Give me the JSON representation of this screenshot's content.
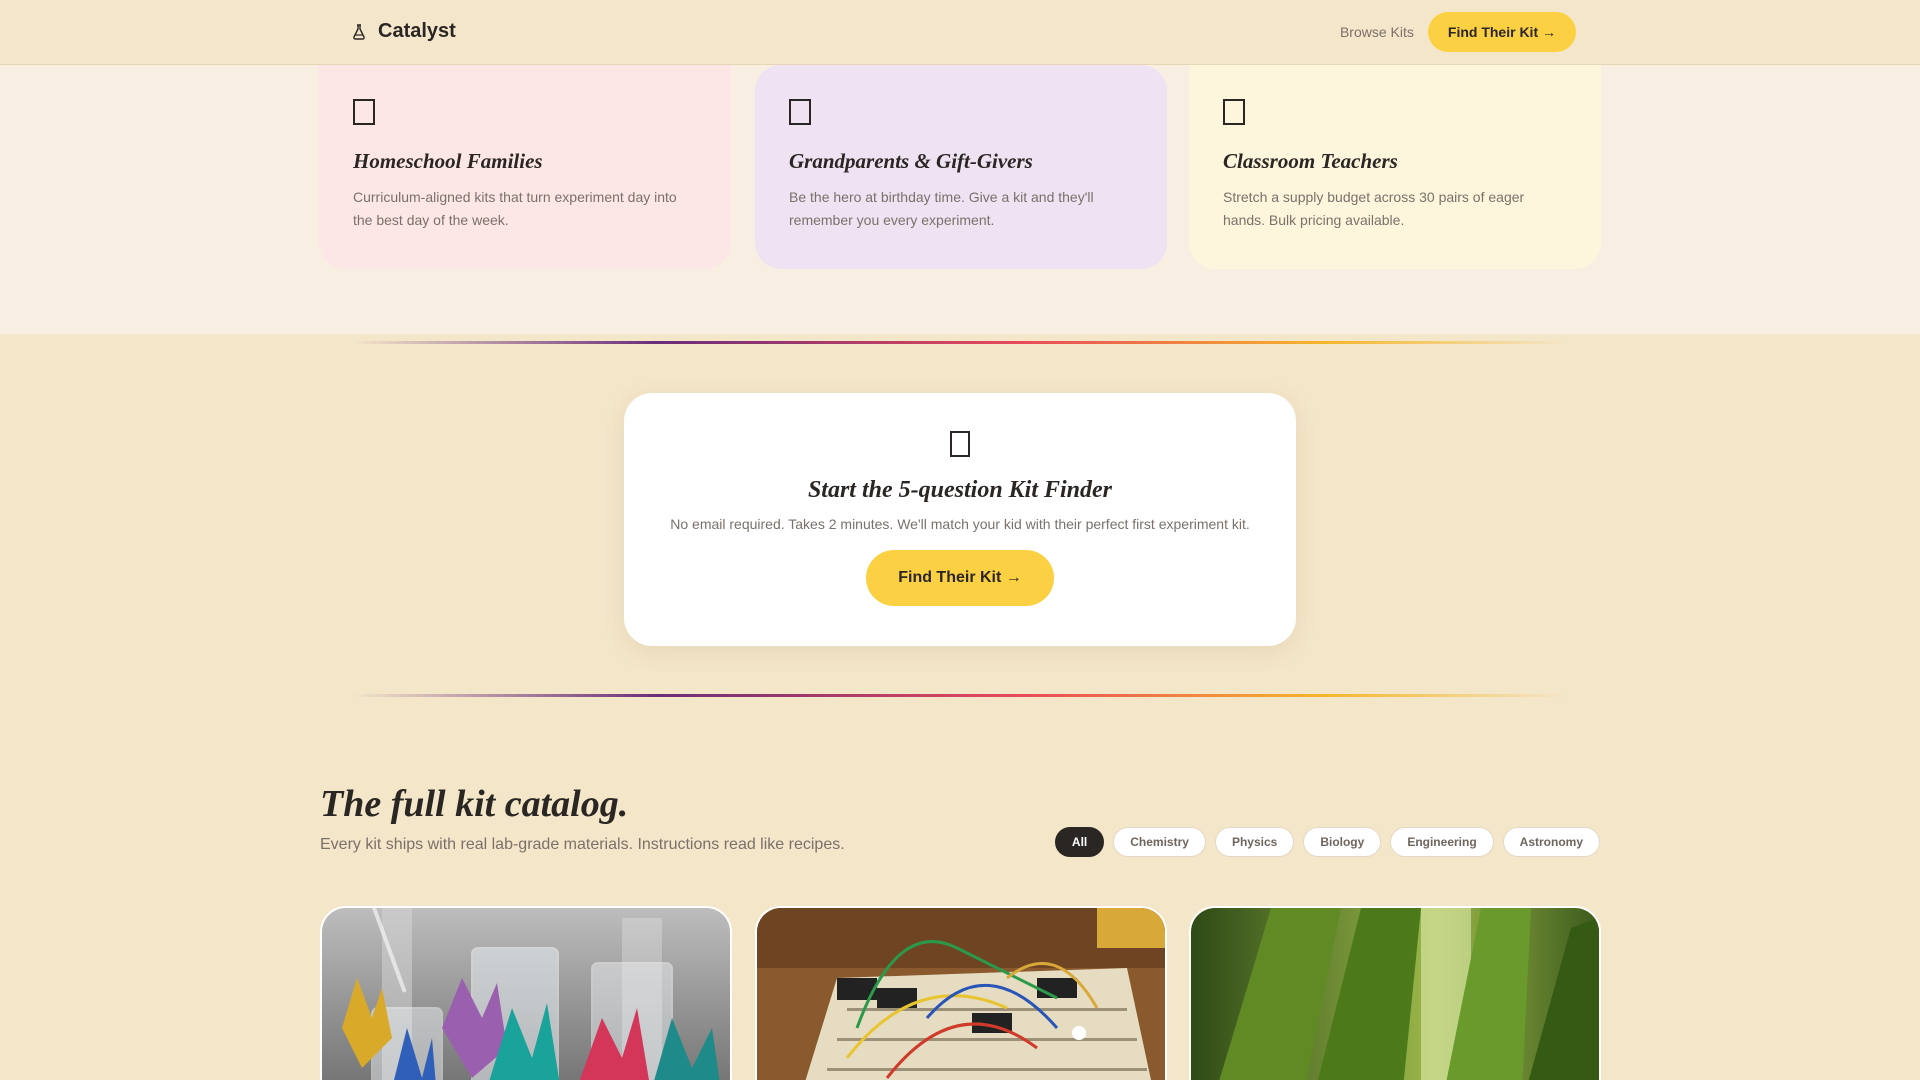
{
  "header": {
    "brand_name": "Catalyst",
    "brand_icon": "flask-icon",
    "nav_link": "Browse Kits",
    "cta_label": "Find Their Kit →"
  },
  "audience": {
    "cards": [
      {
        "icon": "missing-glyph-icon",
        "title": "Homeschool Families",
        "desc": "Curriculum-aligned kits that turn experiment day into the best day of the week.",
        "color": "#fce7e6"
      },
      {
        "icon": "missing-glyph-icon",
        "title": "Grandparents & Gift-Givers",
        "desc": "Be the hero at birthday time. Give a kit and they'll remember you every experiment.",
        "color": "#efe2f3"
      },
      {
        "icon": "missing-glyph-icon",
        "title": "Classroom Teachers",
        "desc": "Stretch a supply budget across 30 pairs of eager hands. Bulk pricing available.",
        "color": "#fef6dc"
      }
    ]
  },
  "finder": {
    "icon": "missing-glyph-icon",
    "title": "Start the 5-question Kit Finder",
    "desc": "No email required. Takes 2 minutes. We'll match your kid with their perfect first experiment kit.",
    "cta_label": "Find Their Kit →"
  },
  "catalog": {
    "title": "The full kit catalog.",
    "subtitle": "Every kit ships with real lab-grade materials. Instructions read like recipes.",
    "filters": [
      "All",
      "Chemistry",
      "Physics",
      "Biology",
      "Engineering",
      "Astronomy"
    ],
    "active_filter": "All",
    "kits": [
      {
        "image": "crystal-beakers-photo",
        "badge_color": "#e94a5a"
      },
      {
        "image": "breadboard-circuit-photo",
        "badge_color": "#fcd043"
      },
      {
        "image": "green-leaves-closeup-photo",
        "badge_color": "#7b3a8c"
      }
    ]
  },
  "colors": {
    "accent_yellow": "#fcd043",
    "page_bg": "#f4e6c9",
    "ink": "#2a2623",
    "muted": "#7a716a"
  }
}
